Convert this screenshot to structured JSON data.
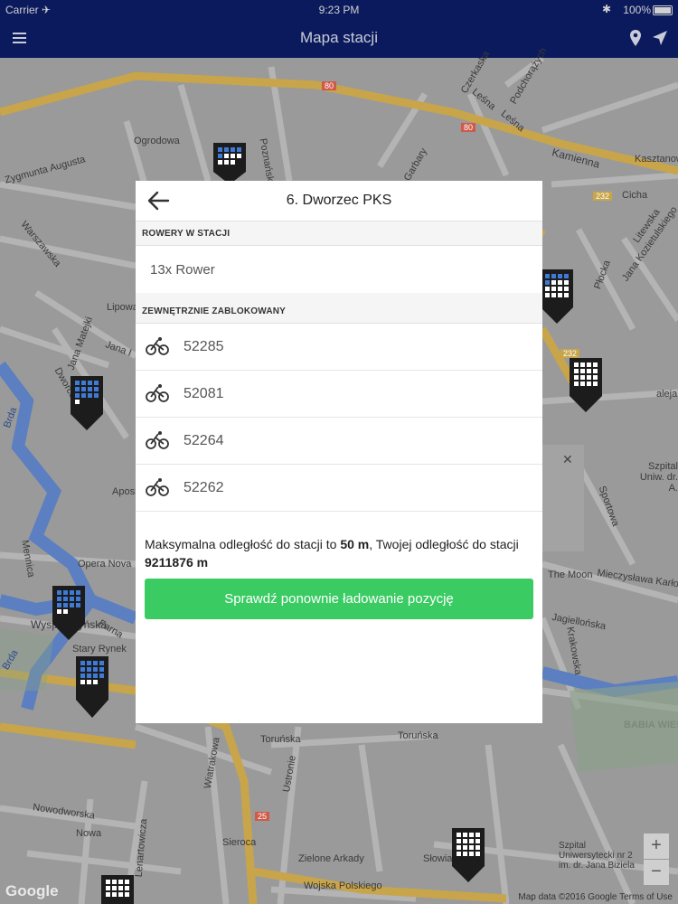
{
  "status_bar": {
    "carrier": "Carrier ✈",
    "time": "9:23 PM",
    "battery": "100%"
  },
  "nav_bar": {
    "title": "Mapa stacji",
    "icons": [
      "menu-icon",
      "location-pin-icon",
      "locate-arrow-icon"
    ]
  },
  "map": {
    "labels": [
      "Ogrodowa",
      "Zygmunta Augusta",
      "Warszawska",
      "Lipowa",
      "Jana Matejki",
      "Jana I",
      "Dworcowa",
      "Brda",
      "Mennica",
      "Opera Nova",
      "Farna",
      "Stary Rynek",
      "Wyspa Młyńska",
      "Brda",
      "Czerkaska",
      "Podchorążych",
      "Leśna",
      "Leśna",
      "Kamienna",
      "Kasztanowa",
      "Cicha",
      "Litewska",
      "Jana Kozietulskiego",
      "Płocka",
      "aleja",
      "Szpital Uniw. dr. A.",
      "Sportowa",
      "The Moon",
      "Mieczysława Karłowicza",
      "Jagiellońska",
      "Krakowska",
      "BABIA WIEŚ",
      "Toruńska",
      "Toruńska",
      "Wiatrakowa",
      "Ustronie",
      "Nowodworska",
      "Nowa",
      "Lenartowicza",
      "Sieroca",
      "Zielone Arkady",
      "Słowiańska",
      "Szpital Uniwersytecki nr 2 im. dr. Jana Biziela",
      "Wojska Polskiego",
      "Aposh",
      "Poznańska",
      "Garbary"
    ],
    "road_badges": [
      "80",
      "80",
      "232",
      "232",
      "25"
    ],
    "google_logo": "Google",
    "attribution": "Map data ©2016 Google   Terms of Use",
    "zoom_in": "+",
    "zoom_out": "−",
    "popup_close": "✕"
  },
  "modal": {
    "title": "6. Dworzec PKS",
    "section_bikes": "ROWERY W STACJI",
    "bikes_summary": "13x Rower",
    "section_locked": "ZEWNĘTRZNIE ZABLOKOWANY",
    "bikes": [
      "52285",
      "52081",
      "52264",
      "52262"
    ],
    "distance_prefix": "Maksymalna odległość do stacji to ",
    "max_distance": "50 m",
    "distance_middle": ", Twojej odległość do stacji",
    "your_distance": "9211876 m",
    "recheck_label": "Sprawdź ponownie ładowanie pozycję"
  },
  "colors": {
    "nav_bg": "#0b1a5c",
    "button_green": "#3acb63",
    "map_gray": "#9a9a9a",
    "road_yellow": "#c8a54a",
    "river_blue": "#5b7fc0"
  }
}
